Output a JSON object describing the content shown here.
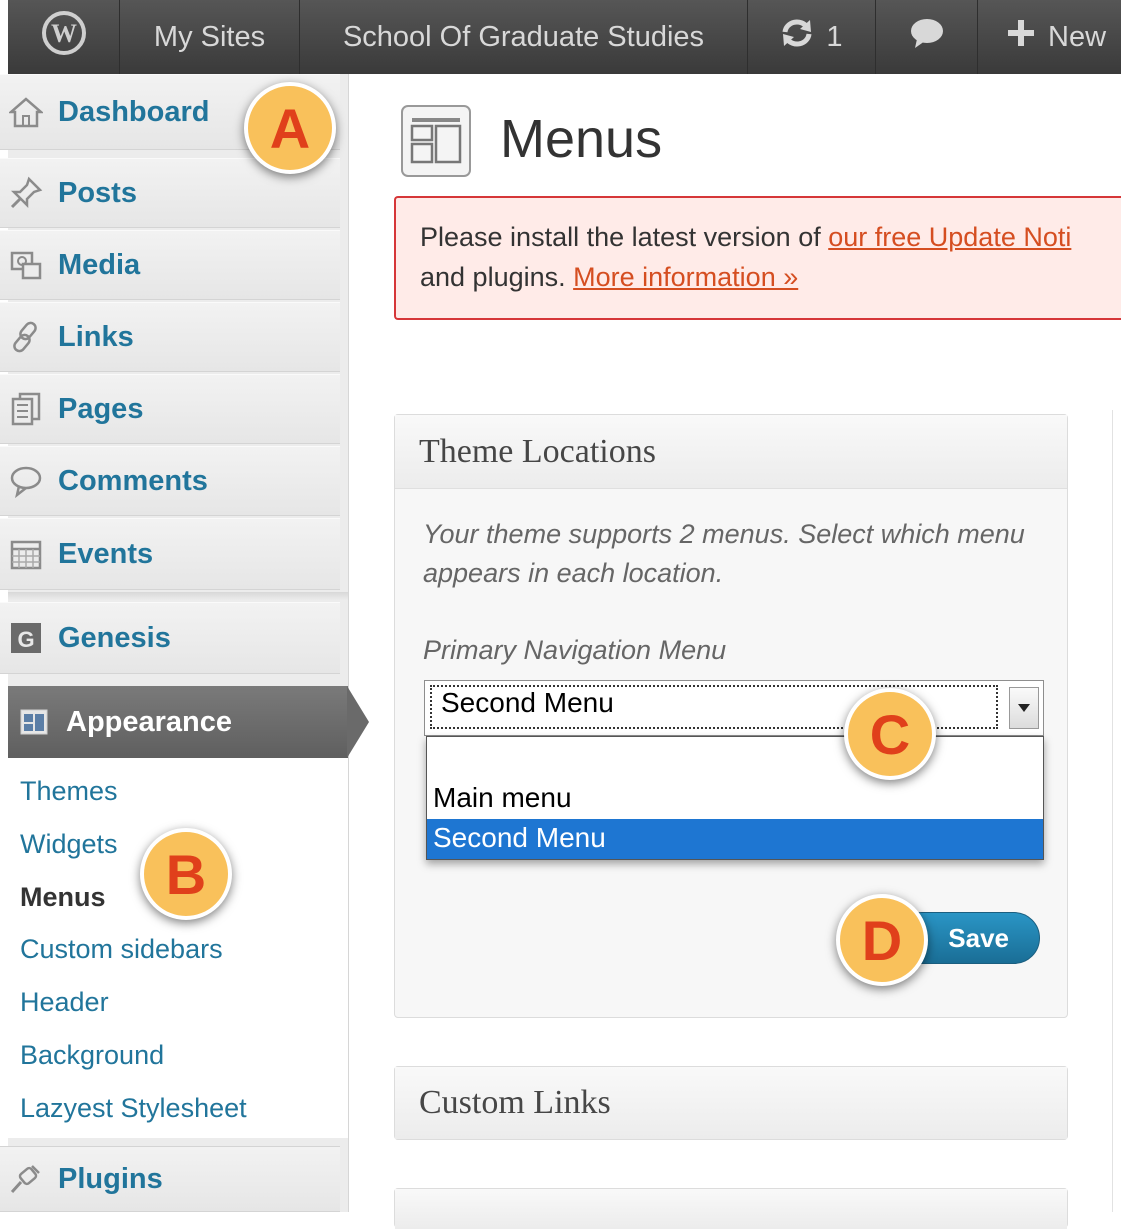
{
  "adminbar": {
    "logo_icon": "wordpress-logo-icon",
    "my_sites": "My Sites",
    "site_name": "School Of Graduate Studies",
    "updates_count": "1",
    "updates_icon": "refresh-icon",
    "comments_icon": "comment-bubble-icon",
    "new_label": "New",
    "new_icon": "plus-icon"
  },
  "sidebar": {
    "items": [
      {
        "label": "Dashboard",
        "icon": "home-icon"
      },
      {
        "label": "Posts",
        "icon": "pushpin-icon"
      },
      {
        "label": "Media",
        "icon": "media-icon"
      },
      {
        "label": "Links",
        "icon": "chain-link-icon"
      },
      {
        "label": "Pages",
        "icon": "pages-icon"
      },
      {
        "label": "Comments",
        "icon": "comment-icon"
      },
      {
        "label": "Events",
        "icon": "calendar-icon"
      },
      {
        "label": "Genesis",
        "icon": "genesis-icon"
      },
      {
        "label": "Appearance",
        "icon": "appearance-icon"
      },
      {
        "label": "Plugins",
        "icon": "plug-icon"
      }
    ],
    "submenu": [
      "Themes",
      "Widgets",
      "Menus",
      "Custom sidebars",
      "Header",
      "Background",
      "Lazyest Stylesheet"
    ],
    "submenu_current": "Menus"
  },
  "page": {
    "title": "Menus",
    "title_icon": "menus-page-icon"
  },
  "notice": {
    "text_before": "Please install the latest version of ",
    "link1": "our free Update Noti",
    "text_middle": "and plugins. ",
    "link2": "More information »"
  },
  "theme_locations": {
    "title": "Theme Locations",
    "description": "Your theme supports 2 menus. Select which menu appears in each location.",
    "field_label": "Primary Navigation Menu",
    "selected_value": "Second Menu",
    "options": [
      "",
      "Main menu",
      "Second Menu"
    ],
    "save_label": "Save"
  },
  "custom_links": {
    "title": "Custom Links"
  },
  "callouts": [
    "A",
    "B",
    "C",
    "D"
  ],
  "colors": {
    "link": "#21759b",
    "admin_bar": "#464646",
    "appearance_active": "#6d6d6d",
    "notice_border": "#d63638",
    "selection": "#1e76d2",
    "save_button": "#1e7ea8",
    "badge_fill": "#f9c15b",
    "badge_text": "#e0401b"
  }
}
